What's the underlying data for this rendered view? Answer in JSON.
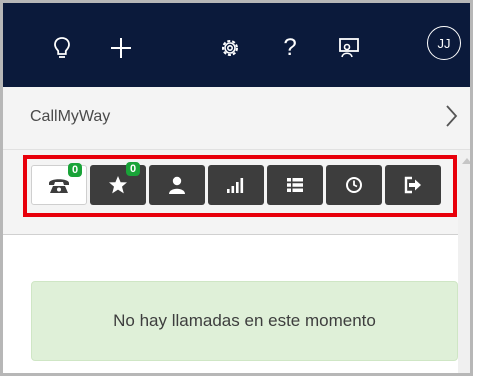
{
  "topbar": {
    "icons": [
      "lightbulb-icon",
      "plus-icon",
      "gear-icon",
      "help-icon",
      "chat-assist-icon"
    ],
    "help_label": "?",
    "avatar_initials": "JJ"
  },
  "breadcrumb": {
    "title": "CallMyWay",
    "chevron": "chevron-right-icon"
  },
  "toolbar": {
    "tabs": [
      {
        "icon": "phone-icon",
        "badge": "0",
        "active": true
      },
      {
        "icon": "star-icon",
        "badge": "0",
        "active": false
      },
      {
        "icon": "user-icon",
        "active": false
      },
      {
        "icon": "signal-bars-icon",
        "active": false
      },
      {
        "icon": "list-icon",
        "active": false
      },
      {
        "icon": "clock-icon",
        "active": false
      },
      {
        "icon": "logout-icon",
        "active": false
      }
    ],
    "highlight_color": "#e8000b"
  },
  "notice": {
    "text": "No hay llamadas en este momento"
  },
  "colors": {
    "topbar": "#0b1a3b",
    "tab": "#3d3d3d",
    "badge": "#19a338",
    "notice_bg": "#dff0d8"
  }
}
